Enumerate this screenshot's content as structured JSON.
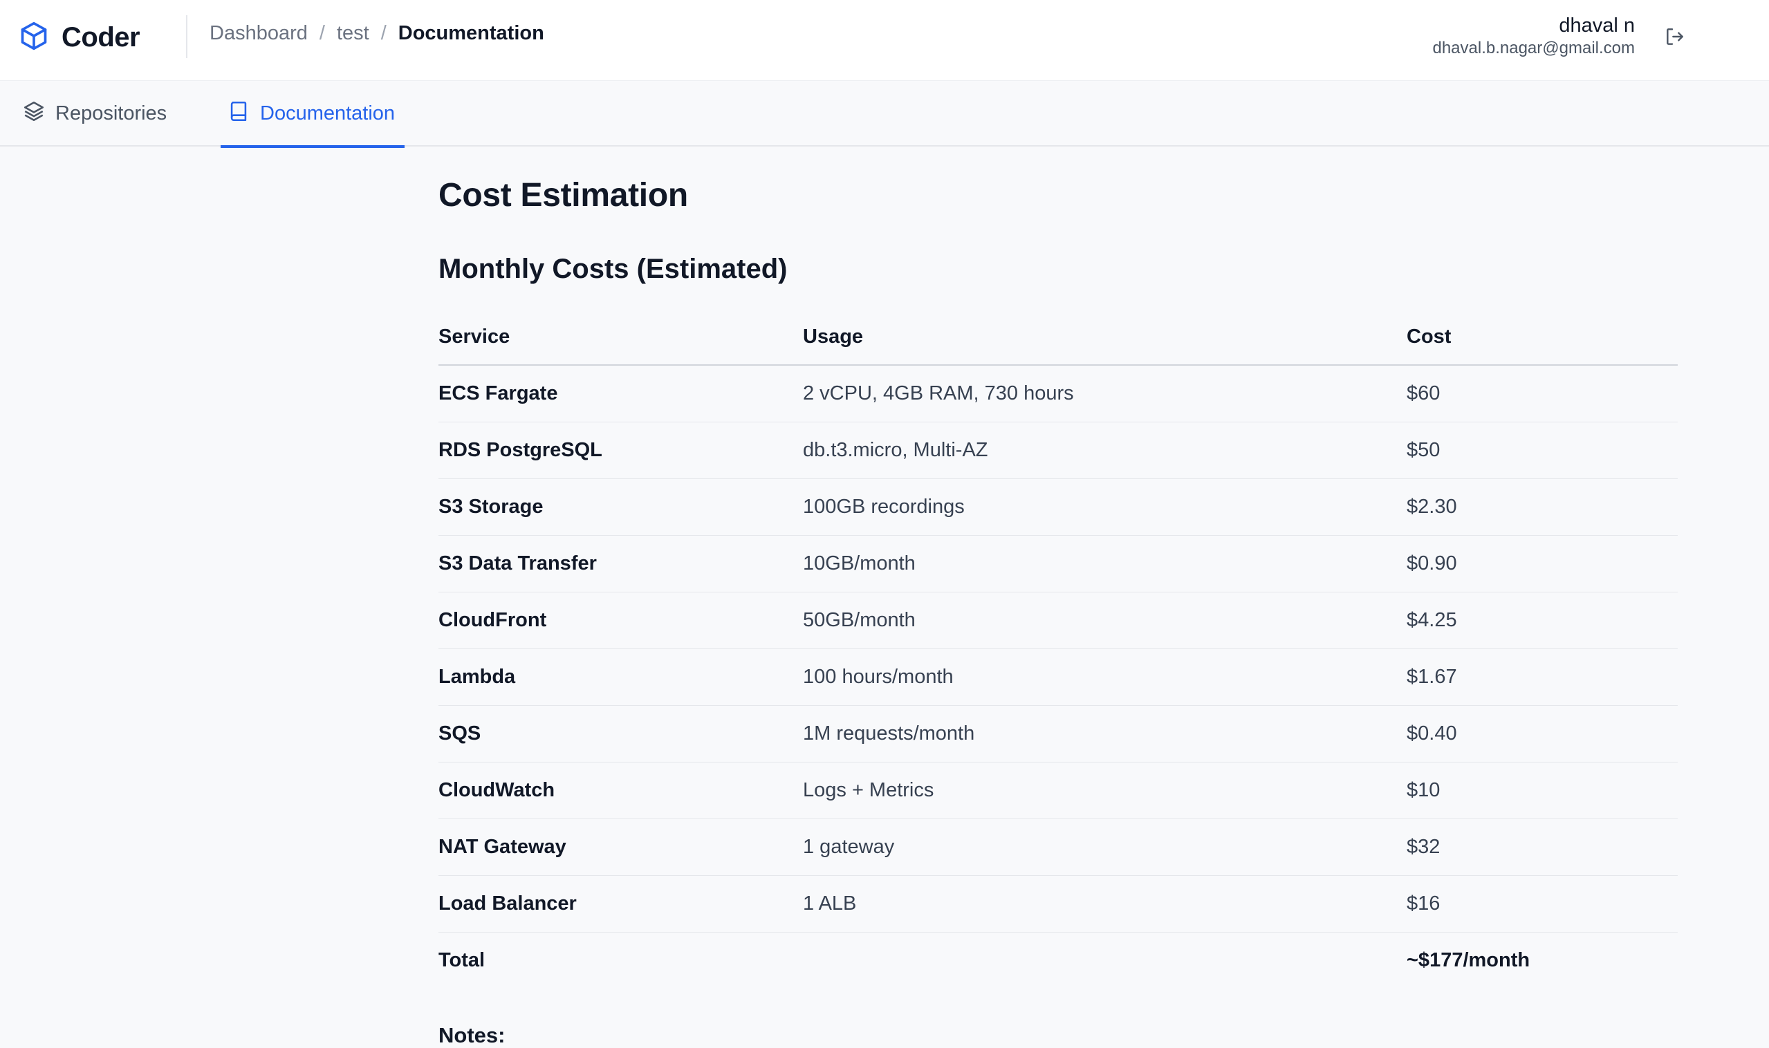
{
  "app": {
    "name": "Coder",
    "logo_icon": "cube-icon",
    "accent_color": "#2563eb"
  },
  "breadcrumb": {
    "items": [
      "Dashboard",
      "test"
    ],
    "separator": "/",
    "current": "Documentation"
  },
  "user": {
    "name": "dhaval n",
    "email": "dhaval.b.nagar@gmail.com",
    "logout_icon": "logout-icon"
  },
  "tabs": [
    {
      "label": "Repositories",
      "icon": "layers-icon",
      "active": false
    },
    {
      "label": "Documentation",
      "icon": "book-icon",
      "active": true
    }
  ],
  "doc": {
    "title": "Cost Estimation",
    "section_title": "Monthly Costs (Estimated)",
    "table": {
      "headers": [
        "Service",
        "Usage",
        "Cost"
      ],
      "rows": [
        {
          "service": "ECS Fargate",
          "usage": "2 vCPU, 4GB RAM, 730 hours",
          "cost": "$60"
        },
        {
          "service": "RDS PostgreSQL",
          "usage": "db.t3.micro, Multi-AZ",
          "cost": "$50"
        },
        {
          "service": "S3 Storage",
          "usage": "100GB recordings",
          "cost": "$2.30"
        },
        {
          "service": "S3 Data Transfer",
          "usage": "10GB/month",
          "cost": "$0.90"
        },
        {
          "service": "CloudFront",
          "usage": "50GB/month",
          "cost": "$4.25"
        },
        {
          "service": "Lambda",
          "usage": "100 hours/month",
          "cost": "$1.67"
        },
        {
          "service": "SQS",
          "usage": "1M requests/month",
          "cost": "$0.40"
        },
        {
          "service": "CloudWatch",
          "usage": "Logs + Metrics",
          "cost": "$10"
        },
        {
          "service": "NAT Gateway",
          "usage": "1 gateway",
          "cost": "$32"
        },
        {
          "service": "Load Balancer",
          "usage": "1 ALB",
          "cost": "$16"
        }
      ],
      "total": {
        "label": "Total",
        "usage": "",
        "cost": "~$177/month"
      }
    },
    "notes_heading": "Notes:"
  }
}
